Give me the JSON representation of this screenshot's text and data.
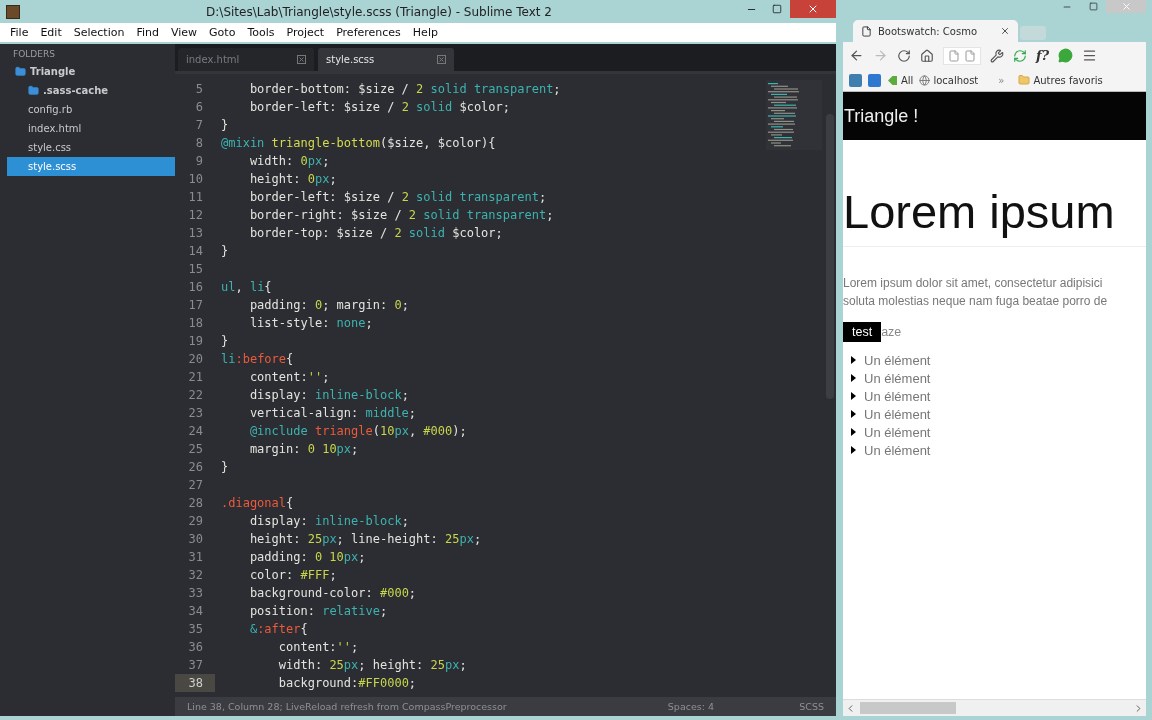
{
  "editor": {
    "title": "D:\\Sites\\Lab\\Triangle\\style.scss (Triangle) - Sublime Text 2",
    "menu": [
      "File",
      "Edit",
      "Selection",
      "Find",
      "View",
      "Goto",
      "Tools",
      "Project",
      "Preferences",
      "Help"
    ],
    "sidebar": {
      "heading": "FOLDERS",
      "tree": [
        {
          "label": "Triangle",
          "kind": "folder",
          "selected": false,
          "children": [
            {
              "label": ".sass-cache",
              "kind": "folder",
              "selected": false
            },
            {
              "label": "config.rb",
              "kind": "file",
              "selected": false
            },
            {
              "label": "index.html",
              "kind": "file",
              "selected": false
            },
            {
              "label": "style.css",
              "kind": "file",
              "selected": false
            },
            {
              "label": "style.scss",
              "kind": "file",
              "selected": true
            }
          ]
        }
      ]
    },
    "tabs": [
      {
        "label": "index.html",
        "selected": false
      },
      {
        "label": "style.scss",
        "selected": true
      }
    ],
    "lines": [
      {
        "number": "5",
        "current": false,
        "tokens": [
          {
            "kind": "text",
            "text": "    border-bottom: $size / "
          },
          {
            "kind": "number",
            "text": "2"
          },
          {
            "kind": "keyword",
            "text": " solid transparent"
          },
          {
            "kind": "text",
            "text": ";"
          }
        ]
      },
      {
        "number": "6",
        "current": false,
        "tokens": [
          {
            "kind": "text",
            "text": "    border-left: $size / "
          },
          {
            "kind": "number",
            "text": "2"
          },
          {
            "kind": "keyword",
            "text": " solid"
          },
          {
            "kind": "text",
            "text": " $color;"
          }
        ]
      },
      {
        "number": "7",
        "current": false,
        "tokens": [
          {
            "kind": "text",
            "text": "}"
          }
        ]
      },
      {
        "number": "8",
        "current": false,
        "tokens": [
          {
            "kind": "keyword",
            "text": "@mixin"
          },
          {
            "kind": "function",
            "text": " triangle-bottom"
          },
          {
            "kind": "text",
            "text": "($size, $color){"
          }
        ]
      },
      {
        "number": "9",
        "current": false,
        "tokens": [
          {
            "kind": "text",
            "text": "    width: "
          },
          {
            "kind": "number",
            "text": "0"
          },
          {
            "kind": "keyword",
            "text": "px"
          },
          {
            "kind": "text",
            "text": ";"
          }
        ]
      },
      {
        "number": "10",
        "current": false,
        "tokens": [
          {
            "kind": "text",
            "text": "    height: "
          },
          {
            "kind": "number",
            "text": "0"
          },
          {
            "kind": "keyword",
            "text": "px"
          },
          {
            "kind": "text",
            "text": ";"
          }
        ]
      },
      {
        "number": "11",
        "current": false,
        "tokens": [
          {
            "kind": "text",
            "text": "    border-left: $size / "
          },
          {
            "kind": "number",
            "text": "2"
          },
          {
            "kind": "keyword",
            "text": " solid transparent"
          },
          {
            "kind": "text",
            "text": ";"
          }
        ]
      },
      {
        "number": "12",
        "current": false,
        "tokens": [
          {
            "kind": "text",
            "text": "    border-right: $size / "
          },
          {
            "kind": "number",
            "text": "2"
          },
          {
            "kind": "keyword",
            "text": " solid transparent"
          },
          {
            "kind": "text",
            "text": ";"
          }
        ]
      },
      {
        "number": "13",
        "current": false,
        "tokens": [
          {
            "kind": "text",
            "text": "    border-top: $size / "
          },
          {
            "kind": "number",
            "text": "2"
          },
          {
            "kind": "keyword",
            "text": " solid"
          },
          {
            "kind": "text",
            "text": " $color;"
          }
        ]
      },
      {
        "number": "14",
        "current": false,
        "tokens": [
          {
            "kind": "text",
            "text": "}"
          }
        ]
      },
      {
        "number": "15",
        "current": false
      },
      {
        "number": "16",
        "current": false,
        "tokens": [
          {
            "kind": "keyword",
            "text": "ul"
          },
          {
            "kind": "text",
            "text": ", "
          },
          {
            "kind": "keyword",
            "text": "li"
          },
          {
            "kind": "text",
            "text": "{"
          }
        ]
      },
      {
        "number": "17",
        "current": false,
        "tokens": [
          {
            "kind": "text",
            "text": "    padding: "
          },
          {
            "kind": "number",
            "text": "0"
          },
          {
            "kind": "text",
            "text": "; margin: "
          },
          {
            "kind": "number",
            "text": "0"
          },
          {
            "kind": "text",
            "text": ";"
          }
        ]
      },
      {
        "number": "18",
        "current": false,
        "tokens": [
          {
            "kind": "text",
            "text": "    list-style: "
          },
          {
            "kind": "keyword",
            "text": "none"
          },
          {
            "kind": "text",
            "text": ";"
          }
        ]
      },
      {
        "number": "19",
        "current": false,
        "tokens": [
          {
            "kind": "text",
            "text": "}"
          }
        ]
      },
      {
        "number": "20",
        "current": false,
        "tokens": [
          {
            "kind": "keyword",
            "text": "li"
          },
          {
            "kind": "selector",
            "text": ":before"
          },
          {
            "kind": "text",
            "text": "{"
          }
        ]
      },
      {
        "number": "21",
        "current": false,
        "tokens": [
          {
            "kind": "text",
            "text": "    content:"
          },
          {
            "kind": "string",
            "text": "''"
          },
          {
            "kind": "text",
            "text": ";"
          }
        ]
      },
      {
        "number": "22",
        "current": false,
        "tokens": [
          {
            "kind": "text",
            "text": "    display: "
          },
          {
            "kind": "keyword",
            "text": "inline-block"
          },
          {
            "kind": "text",
            "text": ";"
          }
        ]
      },
      {
        "number": "23",
        "current": false,
        "tokens": [
          {
            "kind": "text",
            "text": "    vertical-align: "
          },
          {
            "kind": "keyword",
            "text": "middle"
          },
          {
            "kind": "text",
            "text": ";"
          }
        ]
      },
      {
        "number": "24",
        "current": false,
        "tokens": [
          {
            "kind": "keyword",
            "text": "    @include"
          },
          {
            "kind": "selector",
            "text": " triangle"
          },
          {
            "kind": "text",
            "text": "("
          },
          {
            "kind": "number",
            "text": "10"
          },
          {
            "kind": "keyword",
            "text": "px"
          },
          {
            "kind": "text",
            "text": ", "
          },
          {
            "kind": "number",
            "text": "#000"
          },
          {
            "kind": "text",
            "text": ");"
          }
        ]
      },
      {
        "number": "25",
        "current": false,
        "tokens": [
          {
            "kind": "text",
            "text": "    margin: "
          },
          {
            "kind": "number",
            "text": "0 10"
          },
          {
            "kind": "keyword",
            "text": "px"
          },
          {
            "kind": "text",
            "text": ";"
          }
        ]
      },
      {
        "number": "26",
        "current": false,
        "tokens": [
          {
            "kind": "text",
            "text": "}"
          }
        ]
      },
      {
        "number": "27",
        "current": false
      },
      {
        "number": "28",
        "current": false,
        "tokens": [
          {
            "kind": "selector",
            "text": ".diagonal"
          },
          {
            "kind": "text",
            "text": "{"
          }
        ]
      },
      {
        "number": "29",
        "current": false,
        "tokens": [
          {
            "kind": "text",
            "text": "    display: "
          },
          {
            "kind": "keyword",
            "text": "inline-block"
          },
          {
            "kind": "text",
            "text": ";"
          }
        ]
      },
      {
        "number": "30",
        "current": false,
        "tokens": [
          {
            "kind": "text",
            "text": "    height: "
          },
          {
            "kind": "number",
            "text": "25"
          },
          {
            "kind": "keyword",
            "text": "px"
          },
          {
            "kind": "text",
            "text": "; line-height: "
          },
          {
            "kind": "number",
            "text": "25"
          },
          {
            "kind": "keyword",
            "text": "px"
          },
          {
            "kind": "text",
            "text": ";"
          }
        ]
      },
      {
        "number": "31",
        "current": false,
        "tokens": [
          {
            "kind": "text",
            "text": "    padding: "
          },
          {
            "kind": "number",
            "text": "0 10"
          },
          {
            "kind": "keyword",
            "text": "px"
          },
          {
            "kind": "text",
            "text": ";"
          }
        ]
      },
      {
        "number": "32",
        "current": false,
        "tokens": [
          {
            "kind": "text",
            "text": "    color: "
          },
          {
            "kind": "number",
            "text": "#FFF"
          },
          {
            "kind": "text",
            "text": ";"
          }
        ]
      },
      {
        "number": "33",
        "current": false,
        "tokens": [
          {
            "kind": "text",
            "text": "    background-color: "
          },
          {
            "kind": "number",
            "text": "#000"
          },
          {
            "kind": "text",
            "text": ";"
          }
        ]
      },
      {
        "number": "34",
        "current": false,
        "tokens": [
          {
            "kind": "text",
            "text": "    position: "
          },
          {
            "kind": "keyword",
            "text": "relative"
          },
          {
            "kind": "text",
            "text": ";"
          }
        ]
      },
      {
        "number": "35",
        "current": false,
        "tokens": [
          {
            "kind": "keyword",
            "text": "    &"
          },
          {
            "kind": "selector",
            "text": ":after"
          },
          {
            "kind": "text",
            "text": "{"
          }
        ]
      },
      {
        "number": "36",
        "current": false,
        "tokens": [
          {
            "kind": "text",
            "text": "        content:"
          },
          {
            "kind": "string",
            "text": "''"
          },
          {
            "kind": "text",
            "text": ";"
          }
        ]
      },
      {
        "number": "37",
        "current": false,
        "tokens": [
          {
            "kind": "text",
            "text": "        width: "
          },
          {
            "kind": "number",
            "text": "25"
          },
          {
            "kind": "keyword",
            "text": "px"
          },
          {
            "kind": "text",
            "text": "; height: "
          },
          {
            "kind": "number",
            "text": "25"
          },
          {
            "kind": "keyword",
            "text": "px"
          },
          {
            "kind": "text",
            "text": ";"
          }
        ]
      },
      {
        "number": "38",
        "current": true,
        "tokens": [
          {
            "kind": "text",
            "text": "        background:"
          },
          {
            "kind": "number",
            "text": "#FF0000"
          },
          {
            "kind": "text",
            "text": ";"
          }
        ]
      }
    ],
    "status": {
      "message": "Line 38, Column 28; LiveReload refresh from CompassPreprocessor",
      "indentation": "Spaces: 4",
      "syntax": "SCSS"
    }
  },
  "browser": {
    "tabs": [
      {
        "label": "Bootswatch: Cosmo",
        "selected": true
      }
    ],
    "extension_label": "f?",
    "bookmarks": [
      {
        "kind": "app"
      },
      {
        "kind": "blog"
      },
      {
        "kind": "tag",
        "label": "All"
      },
      {
        "kind": "globe",
        "label": "localhost"
      }
    ],
    "more": "»",
    "other_bookmarks": "Autres favoris",
    "page": {
      "brand": "Triangle !",
      "heading": "Lorem ipsum",
      "paragraph_lines": [
        "Lorem ipsum dolor sit amet, consectetur adipisici",
        "soluta molestias neque nam fuga beatae porro de"
      ],
      "label": "test",
      "label_after": "aze",
      "items": [
        "Un élément",
        "Un élément",
        "Un élément",
        "Un élément",
        "Un élément",
        "Un élément"
      ]
    }
  }
}
